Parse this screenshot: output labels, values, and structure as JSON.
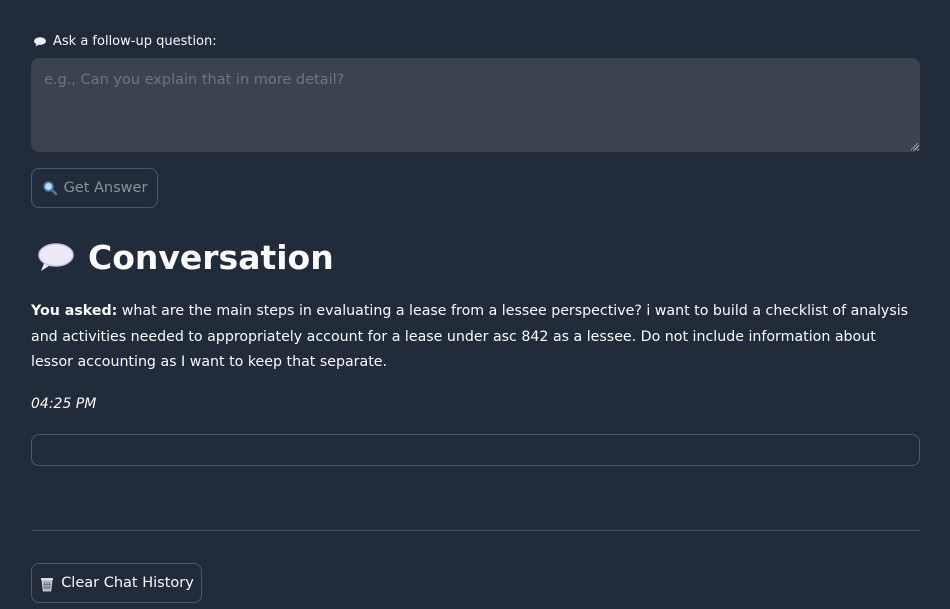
{
  "followup": {
    "label": "Ask a follow-up question:",
    "placeholder": "e.g., Can you explain that in more detail?",
    "value": ""
  },
  "buttons": {
    "get_answer": "Get Answer",
    "clear_history": "Clear Chat History"
  },
  "conversation": {
    "heading": "Conversation",
    "asked_prefix": "You asked:",
    "question": " what are the main steps in evaluating a lease from a lessee perspective? i want to build a checklist of analysis and activities needed to appropriately account for a lease under asc 842 as a lessee. Do not include information about lessor accounting as I want to keep that separate.",
    "time": "04:25 PM",
    "answer": ""
  },
  "icons": {
    "label_icon": "speech-bubble-icon",
    "get_answer_icon": "magnifier-icon",
    "heading_icon": "speech-bubble-icon",
    "clear_icon": "wastebasket-icon"
  },
  "colors": {
    "background": "#212c3b",
    "input_background": "#3a434f",
    "border": "#4e5866",
    "text": "#fafafa",
    "muted_text": "#8b929b"
  }
}
